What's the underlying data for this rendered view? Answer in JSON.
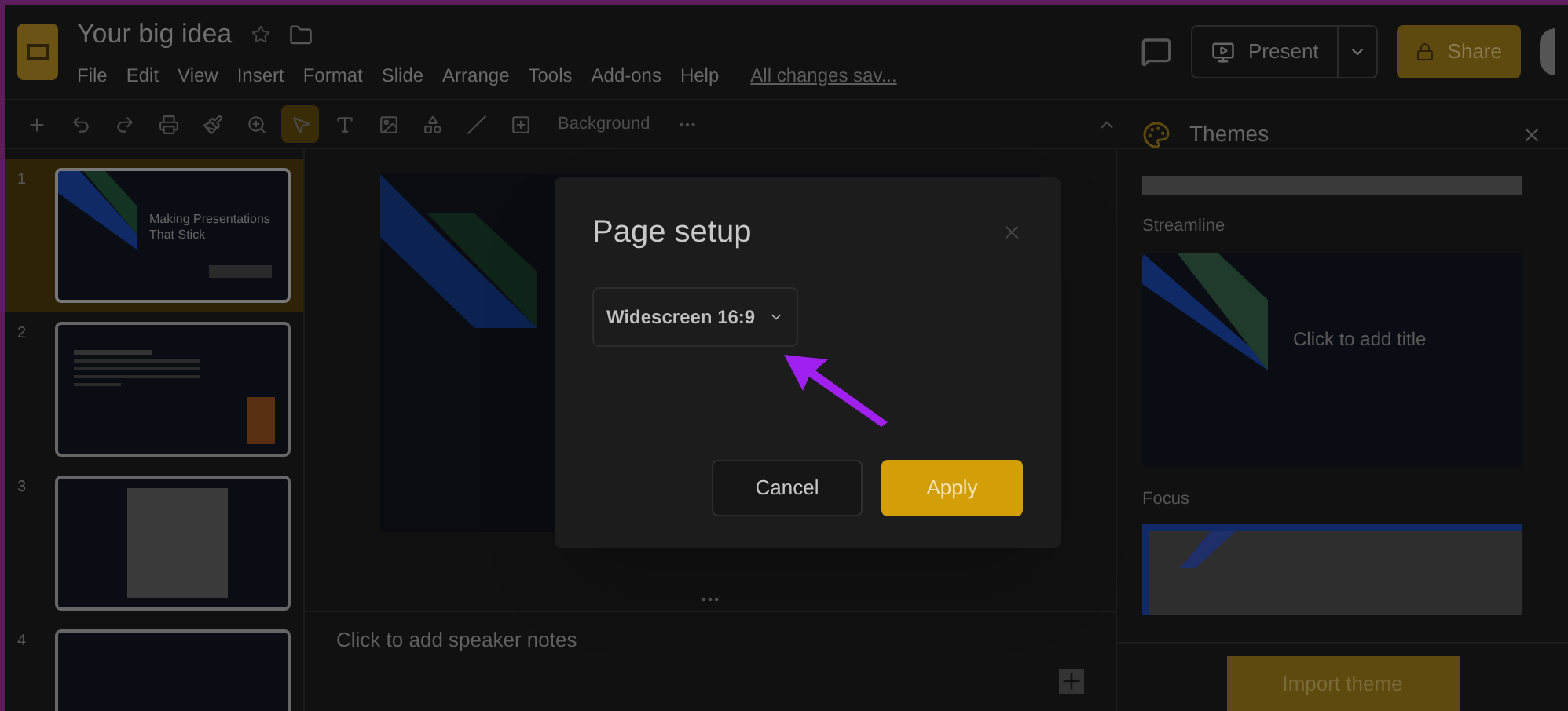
{
  "document": {
    "title": "Your big idea"
  },
  "menu": [
    {
      "label": "File"
    },
    {
      "label": "Edit"
    },
    {
      "label": "View"
    },
    {
      "label": "Insert"
    },
    {
      "label": "Format"
    },
    {
      "label": "Slide"
    },
    {
      "label": "Arrange"
    },
    {
      "label": "Tools"
    },
    {
      "label": "Add-ons"
    },
    {
      "label": "Help"
    }
  ],
  "save_status": "All changes sav...",
  "toolbar": {
    "background_button": "Background"
  },
  "header_buttons": {
    "present": "Present",
    "share": "Share"
  },
  "slides": [
    {
      "number": "1",
      "selected": true,
      "title": "Making Presentations That Stick"
    },
    {
      "number": "2",
      "selected": false
    },
    {
      "number": "3",
      "selected": false
    },
    {
      "number": "4",
      "selected": false
    }
  ],
  "speaker_notes": {
    "placeholder": "Click to add speaker notes"
  },
  "themes_panel": {
    "title": "Themes",
    "themes": [
      {
        "name": "Streamline",
        "preview_title": "Click to add title"
      },
      {
        "name": "Focus"
      }
    ],
    "import_button": "Import theme"
  },
  "dialog": {
    "title": "Page setup",
    "dropdown": "Widescreen 16:9",
    "buttons": [
      {
        "label": "Cancel",
        "kind": "secondary"
      },
      {
        "label": "Apply",
        "kind": "primary"
      }
    ]
  }
}
